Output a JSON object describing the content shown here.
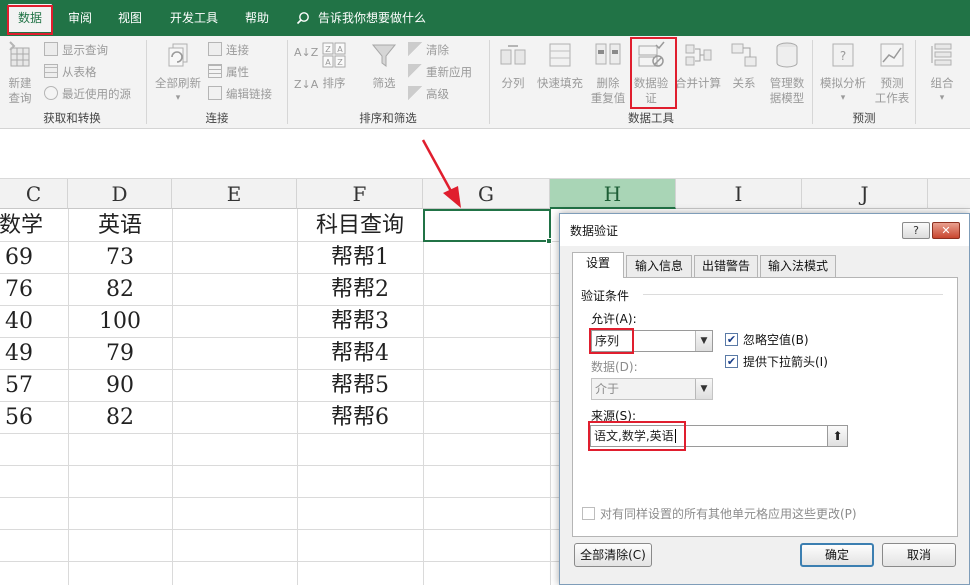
{
  "ribbon_tabs": [
    {
      "label": "数据",
      "active": true
    },
    {
      "label": "审阅"
    },
    {
      "label": "视图"
    },
    {
      "label": "开发工具"
    },
    {
      "label": "帮助"
    }
  ],
  "tell_me": "告诉我你想要做什么",
  "groups": {
    "get_transform": {
      "label": "获取和转换",
      "new_query": "新建\n查询",
      "show_queries": "显示查询",
      "from_table": "从表格",
      "recent_sources": "最近使用的源"
    },
    "connections": {
      "label": "连接",
      "refresh_all": "全部刷新",
      "connections": "连接",
      "properties": "属性",
      "edit_links": "编辑链接"
    },
    "sort_filter": {
      "label": "排序和筛选",
      "sort": "排序",
      "filter": "筛选",
      "clear": "清除",
      "reapply": "重新应用",
      "advanced": "高级",
      "sort_az": "A↓Z",
      "sort_za": "Z↓A"
    },
    "data_tools": {
      "label": "数据工具",
      "text_to_columns": "分列",
      "flash_fill": "快速填充",
      "remove_duplicates": "删除\n重复值",
      "data_validation": "数据验\n证",
      "consolidate": "合并计算",
      "relationships": "关系",
      "manage_data_model": "管理数\n据模型"
    },
    "forecast": {
      "label": "预测",
      "what_if": "模拟分析",
      "forecast_sheet": "预测\n工作表"
    },
    "outline": {
      "group": "组合"
    }
  },
  "columns": [
    "C",
    "D",
    "E",
    "F",
    "G",
    "H",
    "I",
    "J"
  ],
  "selected_column": "H",
  "cells": {
    "C": [
      "数学",
      "69",
      "76",
      "40",
      "49",
      "57",
      "56"
    ],
    "D": [
      "英语",
      "73",
      "82",
      "100",
      "79",
      "90",
      "82"
    ],
    "F": [
      "科目查询",
      "帮帮1",
      "帮帮2",
      "帮帮3",
      "帮帮4",
      "帮帮5",
      "帮帮6"
    ]
  },
  "dialog": {
    "title": "数据验证",
    "help_btn": "?",
    "close_btn": "✕",
    "tabs": [
      "设置",
      "输入信息",
      "出错警告",
      "输入法模式"
    ],
    "active_tab": "设置",
    "section": "验证条件",
    "allow_label": "允许(A):",
    "allow_value": "序列",
    "data_label": "数据(D):",
    "data_value": "介于",
    "ignore_blank": {
      "label": "忽略空值(B)",
      "checked": true
    },
    "in_cell_dropdown": {
      "label": "提供下拉箭头(I)",
      "checked": true
    },
    "source_label": "来源(S):",
    "source_value": "语文,数学,英语",
    "apply_all": {
      "label": "对有同样设置的所有其他单元格应用这些更改(P)",
      "checked": false
    },
    "clear_all": "全部清除(C)",
    "ok": "确定",
    "cancel": "取消"
  },
  "accent_color": "#217346",
  "highlight_color": "#e01e2e"
}
